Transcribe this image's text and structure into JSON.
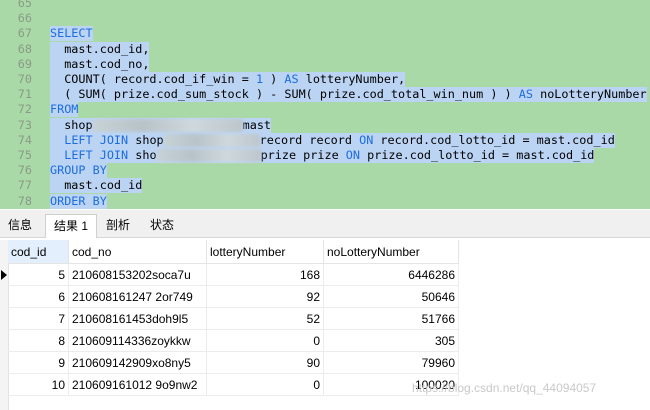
{
  "editor": {
    "lines": [
      {
        "n": "65",
        "segs": []
      },
      {
        "n": "66",
        "segs": []
      },
      {
        "n": "67",
        "segs": [
          {
            "t": "SELECT",
            "c": "kw"
          }
        ]
      },
      {
        "n": "68",
        "segs": [
          {
            "t": "  mast.cod_id,",
            "c": ""
          }
        ]
      },
      {
        "n": "69",
        "segs": [
          {
            "t": "  mast.cod_no,",
            "c": ""
          }
        ]
      },
      {
        "n": "70",
        "segs": [
          {
            "t": "  COUNT( record.cod_if_win = ",
            "c": ""
          },
          {
            "t": "1",
            "c": "num"
          },
          {
            "t": " ) ",
            "c": ""
          },
          {
            "t": "AS",
            "c": "kw"
          },
          {
            "t": " lotteryNumber,",
            "c": ""
          }
        ]
      },
      {
        "n": "71",
        "segs": [
          {
            "t": "  ( SUM( prize.cod_sum_stock ) - SUM( prize.cod_total_win_num ) ) ",
            "c": ""
          },
          {
            "t": "AS",
            "c": "kw"
          },
          {
            "t": " noLotteryNumber",
            "c": ""
          }
        ]
      },
      {
        "n": "72",
        "segs": [
          {
            "t": "FROM",
            "c": "kw"
          }
        ]
      },
      {
        "n": "73",
        "segs": [
          {
            "t": "  shop",
            "c": ""
          },
          {
            "t": "",
            "c": "blur",
            "w": 150
          },
          {
            "t": "mast",
            "c": ""
          }
        ]
      },
      {
        "n": "74",
        "segs": [
          {
            "t": "  ",
            "c": ""
          },
          {
            "t": "LEFT JOIN",
            "c": "kw"
          },
          {
            "t": " shop",
            "c": ""
          },
          {
            "t": "",
            "c": "blur",
            "w": 96
          },
          {
            "t": "record record ",
            "c": ""
          },
          {
            "t": "ON",
            "c": "kw"
          },
          {
            "t": " record.cod_lotto_id = mast.cod_id",
            "c": ""
          }
        ]
      },
      {
        "n": "75",
        "segs": [
          {
            "t": "  ",
            "c": ""
          },
          {
            "t": "LEFT JOIN",
            "c": "kw"
          },
          {
            "t": " sho",
            "c": ""
          },
          {
            "t": "",
            "c": "blur",
            "w": 104
          },
          {
            "t": "prize prize ",
            "c": ""
          },
          {
            "t": "ON",
            "c": "kw"
          },
          {
            "t": " prize.cod_lotto_id = mast.cod_id",
            "c": ""
          }
        ]
      },
      {
        "n": "76",
        "segs": [
          {
            "t": "GROUP BY",
            "c": "kw"
          }
        ]
      },
      {
        "n": "77",
        "segs": [
          {
            "t": "  mast.cod_id",
            "c": ""
          }
        ]
      },
      {
        "n": "78",
        "segs": [
          {
            "t": "ORDER BY",
            "c": "kw"
          }
        ]
      },
      {
        "n": "79",
        "segs": [
          {
            "t": "  mast.dat_create",
            "c": ""
          }
        ]
      }
    ]
  },
  "tabs": [
    "信息",
    "结果 1",
    "剖析",
    "状态"
  ],
  "active_tab": 1,
  "grid": {
    "columns": [
      "cod_id",
      "cod_no",
      "lotteryNumber",
      "noLotteryNumber"
    ],
    "rows": [
      [
        "5",
        "210608153202soca7u",
        "168",
        "6446286"
      ],
      [
        "6",
        "210608161247 2or749",
        "92",
        "50646"
      ],
      [
        "7",
        "210608161453doh9l5",
        "52",
        "51766"
      ],
      [
        "8",
        "210609114336zoykkw",
        "0",
        "305"
      ],
      [
        "9",
        "210609142909xo8ny5",
        "90",
        "79960"
      ],
      [
        "10",
        "210609161012 9o9nw2",
        "0",
        "100020"
      ]
    ]
  },
  "watermark": "https://blog.csdn.net/qq_44094057"
}
